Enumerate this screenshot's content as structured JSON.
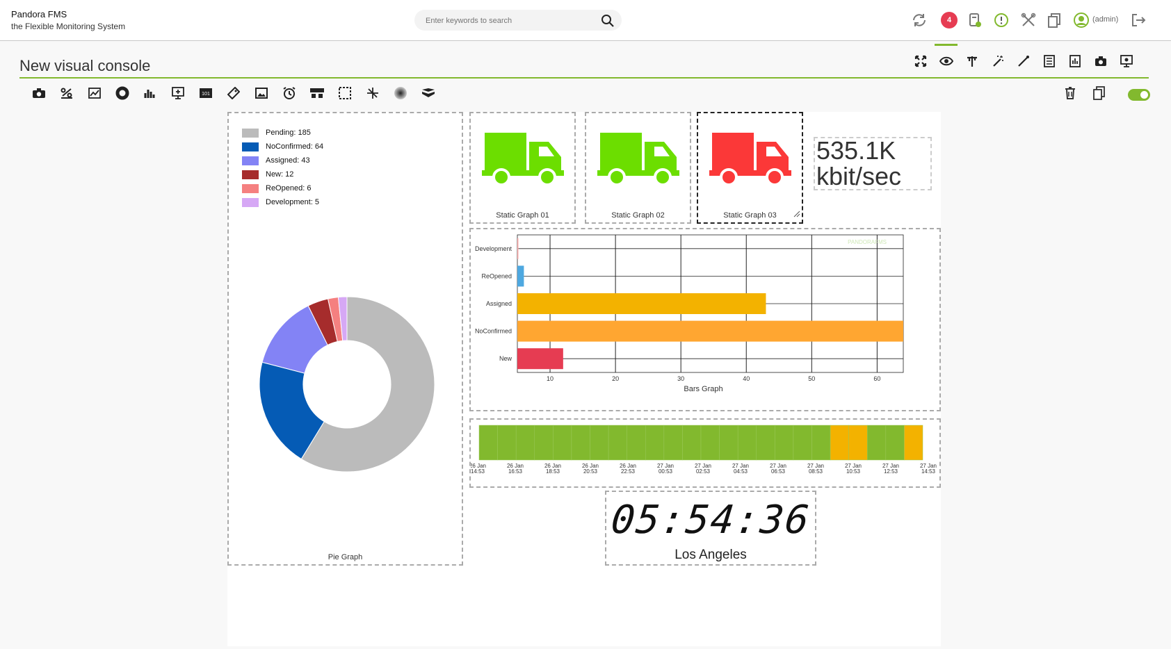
{
  "header": {
    "brand_name": "Pandora FMS",
    "brand_subtitle": "the Flexible Monitoring System",
    "search_placeholder": "Enter keywords to search",
    "alert_count": "4",
    "user": "(admin)"
  },
  "page": {
    "title": "New visual console"
  },
  "colors": {
    "accent": "#82b92e",
    "alert": "#e63c52",
    "ok_green": "#6cde00",
    "critical_red": "#fb3838"
  },
  "mode_tabs": [
    {
      "name": "fullscreen",
      "icon": "fullscreen-icon"
    },
    {
      "name": "view",
      "icon": "eye-icon",
      "active": true
    },
    {
      "name": "setup",
      "icon": "setup-icon"
    },
    {
      "name": "wizard",
      "icon": "wand-icon"
    },
    {
      "name": "services-wizard",
      "icon": "wand-alt-icon"
    },
    {
      "name": "list-of-elements",
      "icon": "list-icon"
    },
    {
      "name": "graphs",
      "icon": "graph-icon"
    },
    {
      "name": "snapshot",
      "icon": "camera-icon"
    },
    {
      "name": "public-link",
      "icon": "monitor-icon"
    }
  ],
  "toolbox": [
    "static-image-icon",
    "percentile-icon",
    "module-graph-icon",
    "donut-icon",
    "bars-icon",
    "auto-sla-icon",
    "simple-value-icon",
    "label-icon",
    "icon-element-icon",
    "clock-icon",
    "group-icon",
    "box-icon",
    "line-icon",
    "color-cloud-icon",
    "network-link-icon"
  ],
  "pie_graph": {
    "label": "Pie Graph",
    "legend": [
      {
        "label": "Pending: 185",
        "color": "#bbbbbb"
      },
      {
        "label": "NoConfirmed: 64",
        "color": "#055bb5"
      },
      {
        "label": "Assigned: 43",
        "color": "#8383f5"
      },
      {
        "label": "New: 12",
        "color": "#a62c2c"
      },
      {
        "label": "ReOpened: 6",
        "color": "#f58080"
      },
      {
        "label": "Development: 5",
        "color": "#d6a8f5"
      }
    ]
  },
  "static_graphs": [
    {
      "label": "Static Graph 01",
      "color": "#6cde00"
    },
    {
      "label": "Static Graph 02",
      "color": "#6cde00"
    },
    {
      "label": "Static Graph 03",
      "color": "#fb3838"
    }
  ],
  "simple_value": {
    "value": "535.1K",
    "unit": "kbit/sec"
  },
  "bars_graph": {
    "label": "Bars Graph",
    "watermark": "PANDORAFMS"
  },
  "chart_data": [
    {
      "type": "pie",
      "categories": [
        "Pending",
        "NoConfirmed",
        "Assigned",
        "New",
        "ReOpened",
        "Development"
      ],
      "values": [
        185,
        64,
        43,
        12,
        6,
        5
      ],
      "colors": [
        "#bbbbbb",
        "#055bb5",
        "#8383f5",
        "#a62c2c",
        "#f58080",
        "#d6a8f5"
      ],
      "title": "Pie Graph",
      "legend_position": "top-left"
    },
    {
      "type": "bar",
      "orientation": "horizontal",
      "categories": [
        "Development",
        "ReOpened",
        "Assigned",
        "NoConfirmed",
        "New"
      ],
      "values": [
        5,
        6,
        43,
        64,
        12
      ],
      "colors": [
        "#ffaaaa",
        "#4ea8e0",
        "#f3b200",
        "#ffa631",
        "#e63c52"
      ],
      "xlim": [
        5,
        64
      ],
      "xticks": [
        10,
        20,
        30,
        40,
        50,
        60
      ],
      "grid": true,
      "title": "Bars Graph"
    },
    {
      "type": "heatmap",
      "title": "",
      "tick_labels": [
        {
          "date": "26 Jan",
          "time": "14:53"
        },
        {
          "date": "26 Jan",
          "time": "16:53"
        },
        {
          "date": "26 Jan",
          "time": "18:53"
        },
        {
          "date": "26 Jan",
          "time": "20:53"
        },
        {
          "date": "26 Jan",
          "time": "22:53"
        },
        {
          "date": "27 Jan",
          "time": "00:53"
        },
        {
          "date": "27 Jan",
          "time": "02:53"
        },
        {
          "date": "27 Jan",
          "time": "04:53"
        },
        {
          "date": "27 Jan",
          "time": "06:53"
        },
        {
          "date": "27 Jan",
          "time": "08:53"
        },
        {
          "date": "27 Jan",
          "time": "10:53"
        },
        {
          "date": "27 Jan",
          "time": "12:53"
        },
        {
          "date": "27 Jan",
          "time": "14:53"
        }
      ],
      "segments": [
        "ok",
        "ok",
        "ok",
        "ok",
        "ok",
        "ok",
        "ok",
        "ok",
        "ok",
        "ok",
        "ok",
        "ok",
        "ok",
        "ok",
        "ok",
        "ok",
        "ok",
        "ok",
        "ok",
        "warning",
        "warning",
        "ok",
        "ok",
        "warning"
      ],
      "status_colors": {
        "ok": "#82b92e",
        "warning": "#f3b200"
      }
    }
  ],
  "clock": {
    "time": "05:54:36",
    "city": "Los Angeles"
  }
}
